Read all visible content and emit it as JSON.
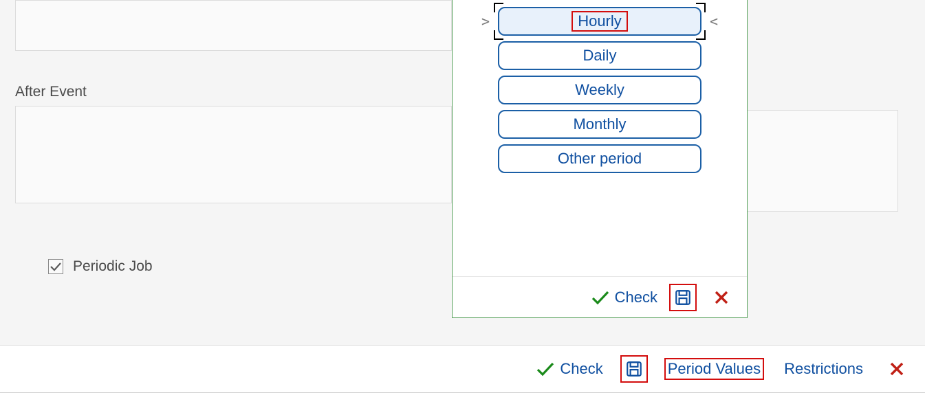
{
  "sections": {
    "after_event_label": "After Event"
  },
  "periodic_job": {
    "label": "Periodic Job",
    "checked": true
  },
  "period_dialog": {
    "options": [
      "Hourly",
      "Daily",
      "Weekly",
      "Monthly",
      "Other period"
    ],
    "selected_index": 0,
    "footer": {
      "check_label": "Check"
    }
  },
  "main_footer": {
    "check_label": "Check",
    "period_values_label": "Period Values",
    "restrictions_label": "Restrictions"
  },
  "highlights": {
    "option_hourly": true,
    "dialog_save": true,
    "main_save": true,
    "main_period_values": true
  },
  "colors": {
    "link_blue": "#0f4fa0",
    "button_border_blue": "#1b5fa6",
    "green_border": "#57a15a",
    "green_check": "#1a8a1a",
    "red_highlight": "#d30d0d",
    "red_close": "#c02016"
  }
}
